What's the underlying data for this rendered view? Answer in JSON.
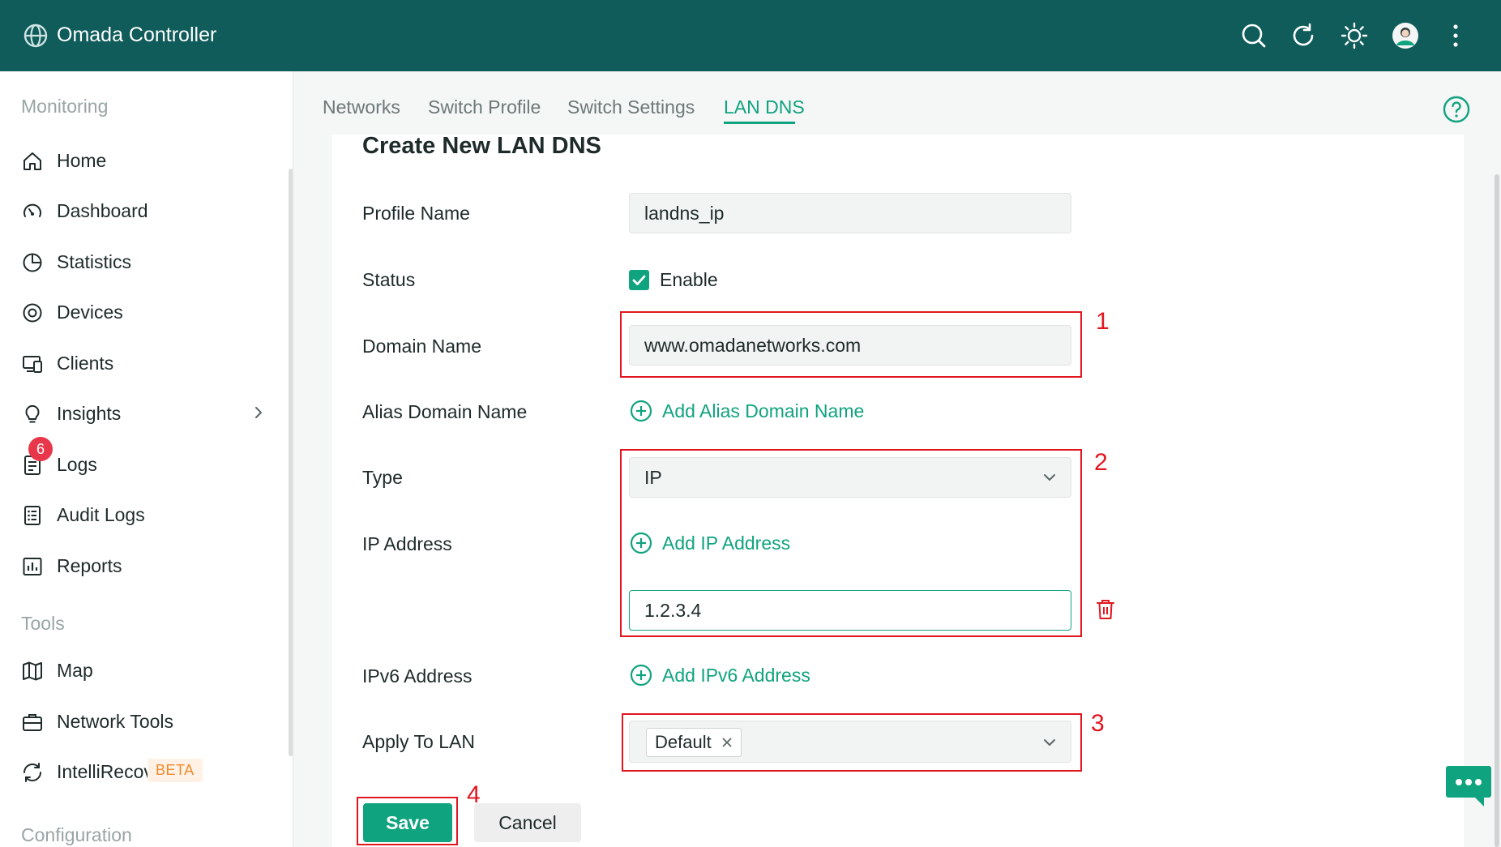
{
  "header": {
    "app_title": "Omada Controller",
    "icons": [
      "globe-logo-icon",
      "search-icon",
      "refresh-icon",
      "theme-sun-icon",
      "avatar",
      "more-vertical-icon"
    ]
  },
  "sidebar": {
    "monitoring_heading": "Monitoring",
    "items": [
      {
        "label": "Home",
        "icon": "home-icon"
      },
      {
        "label": "Dashboard",
        "icon": "dashboard-gauge-icon"
      },
      {
        "label": "Statistics",
        "icon": "pie-chart-icon"
      },
      {
        "label": "Devices",
        "icon": "devices-target-icon"
      },
      {
        "label": "Clients",
        "icon": "clients-monitor-icon"
      },
      {
        "label": "Insights",
        "icon": "lightbulb-icon"
      },
      {
        "label": "Logs",
        "icon": "logs-document-icon",
        "badge": "6"
      },
      {
        "label": "Audit Logs",
        "icon": "audit-list-icon"
      },
      {
        "label": "Reports",
        "icon": "reports-chart-icon"
      }
    ],
    "tools_heading": "Tools",
    "tool_items": [
      {
        "label": "Map",
        "icon": "map-icon"
      },
      {
        "label": "Network Tools",
        "icon": "toolbox-icon"
      },
      {
        "label": "IntelliRecover",
        "icon": "recover-icon",
        "tag": "BETA"
      }
    ],
    "configuration_heading": "Configuration"
  },
  "tabs": [
    {
      "label": "Networks",
      "active": false
    },
    {
      "label": "Switch Profile",
      "active": false
    },
    {
      "label": "Switch Settings",
      "active": false
    },
    {
      "label": "LAN DNS",
      "active": true
    }
  ],
  "form": {
    "title": "Create New LAN DNS",
    "profile_name_label": "Profile Name",
    "profile_name_value": "landns_ip",
    "status_label": "Status",
    "status_checkbox_label": "Enable",
    "status_checked": true,
    "domain_name_label": "Domain Name",
    "domain_name_value": "www.omadanetworks.com",
    "alias_label": "Alias Domain Name",
    "alias_add_label": "Add Alias Domain Name",
    "type_label": "Type",
    "type_value": "IP",
    "ip_label": "IP Address",
    "ip_add_label": "Add IP Address",
    "ip_value": "1.2.3.4",
    "ipv6_label": "IPv6 Address",
    "ipv6_add_label": "Add IPv6 Address",
    "apply_label": "Apply To LAN",
    "apply_tag": "Default",
    "save_label": "Save",
    "cancel_label": "Cancel"
  },
  "annotations": [
    "1",
    "2",
    "3",
    "4"
  ],
  "colors": {
    "header_bg": "#0f5c5a",
    "accent": "#10a37f",
    "annotation_red": "#e1161f",
    "badge_red": "#e8374a",
    "beta_text": "#f08a2c"
  }
}
